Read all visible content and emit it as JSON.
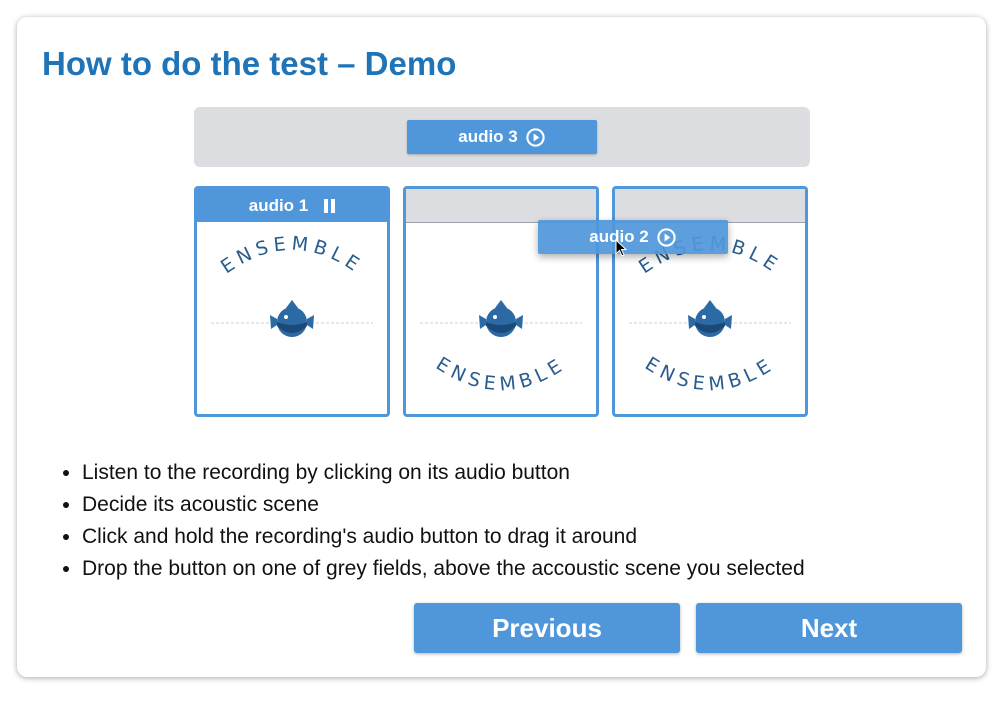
{
  "page": {
    "title": "How to do the test – Demo"
  },
  "audio_buttons": {
    "audio3": "audio 3",
    "audio1": "audio 1",
    "audio2": "audio 2"
  },
  "scene_logo_text": "ENSEMBLE",
  "instructions": [
    "Listen to the recording by clicking on its audio button",
    "Decide its acoustic scene",
    "Click and hold the recording's audio button to drag it around",
    "Drop the button on one of grey fields, above the accoustic scene you selected"
  ],
  "nav": {
    "previous": "Previous",
    "next": "Next"
  },
  "colors": {
    "accent": "#4f97da",
    "title": "#1f73b7",
    "tray": "#dcdde1"
  },
  "icons": {
    "play": "play-circle-icon",
    "pause": "pause-icon",
    "fish": "fish-icon",
    "cursor": "mouse-pointer-icon"
  }
}
